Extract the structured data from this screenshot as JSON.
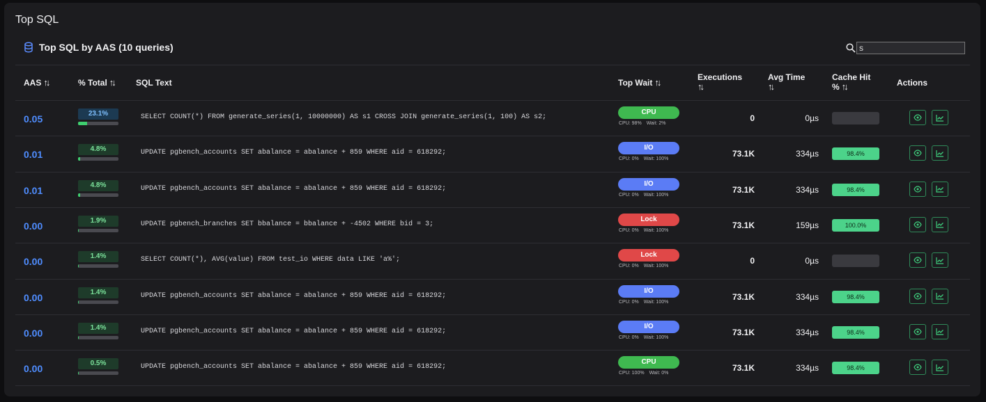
{
  "page_title": "Top SQL",
  "section": {
    "title": "Top SQL by AAS (10 queries)"
  },
  "search": {
    "value": "s"
  },
  "columns": {
    "aas": "AAS",
    "pct_total": "% Total",
    "sql_text": "SQL Text",
    "top_wait": "Top Wait",
    "executions": "Executions",
    "avg_time": "Avg Time",
    "cache_hit_1": "Cache Hit",
    "cache_hit_2": "%",
    "actions": "Actions"
  },
  "sort_icon": "↑↓",
  "icons": {
    "database": "database-icon",
    "search": "search-icon",
    "view": "eye-icon",
    "chart": "line-chart-icon"
  },
  "colors": {
    "aas": "#4f8dff",
    "cpu": "#3fb950",
    "io": "#5b7cf5",
    "lock": "#e04848",
    "cache_hit": "#4cd38a"
  },
  "rows": [
    {
      "aas": "0.05",
      "pct": "23.1%",
      "pct_value": 23.1,
      "pct_style": "blue",
      "sql": "SELECT COUNT(*) FROM generate_series(1, 10000000) AS s1 CROSS JOIN generate_series(1, 100) AS s2;",
      "wait": "CPU",
      "wait_type": "cpu",
      "cpu": "CPU: 98%",
      "wait_pct": "Wait: 2%",
      "executions": "0",
      "avg_time": "0µs",
      "cache": ""
    },
    {
      "aas": "0.01",
      "pct": "4.8%",
      "pct_value": 4.8,
      "pct_style": "green",
      "sql": "UPDATE pgbench_accounts SET abalance = abalance + 859 WHERE aid = 618292;",
      "wait": "I/O",
      "wait_type": "io",
      "cpu": "CPU: 0%",
      "wait_pct": "Wait: 100%",
      "executions": "73.1K",
      "avg_time": "334µs",
      "cache": "98.4%"
    },
    {
      "aas": "0.01",
      "pct": "4.8%",
      "pct_value": 4.8,
      "pct_style": "green",
      "sql": "UPDATE pgbench_accounts SET abalance = abalance + 859 WHERE aid = 618292;",
      "wait": "I/O",
      "wait_type": "io",
      "cpu": "CPU: 0%",
      "wait_pct": "Wait: 100%",
      "executions": "73.1K",
      "avg_time": "334µs",
      "cache": "98.4%"
    },
    {
      "aas": "0.00",
      "pct": "1.9%",
      "pct_value": 1.9,
      "pct_style": "green",
      "sql": "UPDATE pgbench_branches SET bbalance = bbalance + -4502 WHERE bid = 3;",
      "wait": "Lock",
      "wait_type": "lock",
      "cpu": "CPU: 0%",
      "wait_pct": "Wait: 100%",
      "executions": "73.1K",
      "avg_time": "159µs",
      "cache": "100.0%"
    },
    {
      "aas": "0.00",
      "pct": "1.4%",
      "pct_value": 1.4,
      "pct_style": "green",
      "sql": "SELECT COUNT(*), AVG(value) FROM test_io WHERE data LIKE 'a%';",
      "wait": "Lock",
      "wait_type": "lock",
      "cpu": "CPU: 0%",
      "wait_pct": "Wait: 100%",
      "executions": "0",
      "avg_time": "0µs",
      "cache": ""
    },
    {
      "aas": "0.00",
      "pct": "1.4%",
      "pct_value": 1.4,
      "pct_style": "green",
      "sql": "UPDATE pgbench_accounts SET abalance = abalance + 859 WHERE aid = 618292;",
      "wait": "I/O",
      "wait_type": "io",
      "cpu": "CPU: 0%",
      "wait_pct": "Wait: 100%",
      "executions": "73.1K",
      "avg_time": "334µs",
      "cache": "98.4%"
    },
    {
      "aas": "0.00",
      "pct": "1.4%",
      "pct_value": 1.4,
      "pct_style": "green",
      "sql": "UPDATE pgbench_accounts SET abalance = abalance + 859 WHERE aid = 618292;",
      "wait": "I/O",
      "wait_type": "io",
      "cpu": "CPU: 0%",
      "wait_pct": "Wait: 100%",
      "executions": "73.1K",
      "avg_time": "334µs",
      "cache": "98.4%"
    },
    {
      "aas": "0.00",
      "pct": "0.5%",
      "pct_value": 0.5,
      "pct_style": "green",
      "sql": "UPDATE pgbench_accounts SET abalance = abalance + 859 WHERE aid = 618292;",
      "wait": "CPU",
      "wait_type": "cpu",
      "cpu": "CPU: 100%",
      "wait_pct": "Wait: 0%",
      "executions": "73.1K",
      "avg_time": "334µs",
      "cache": "98.4%"
    }
  ]
}
